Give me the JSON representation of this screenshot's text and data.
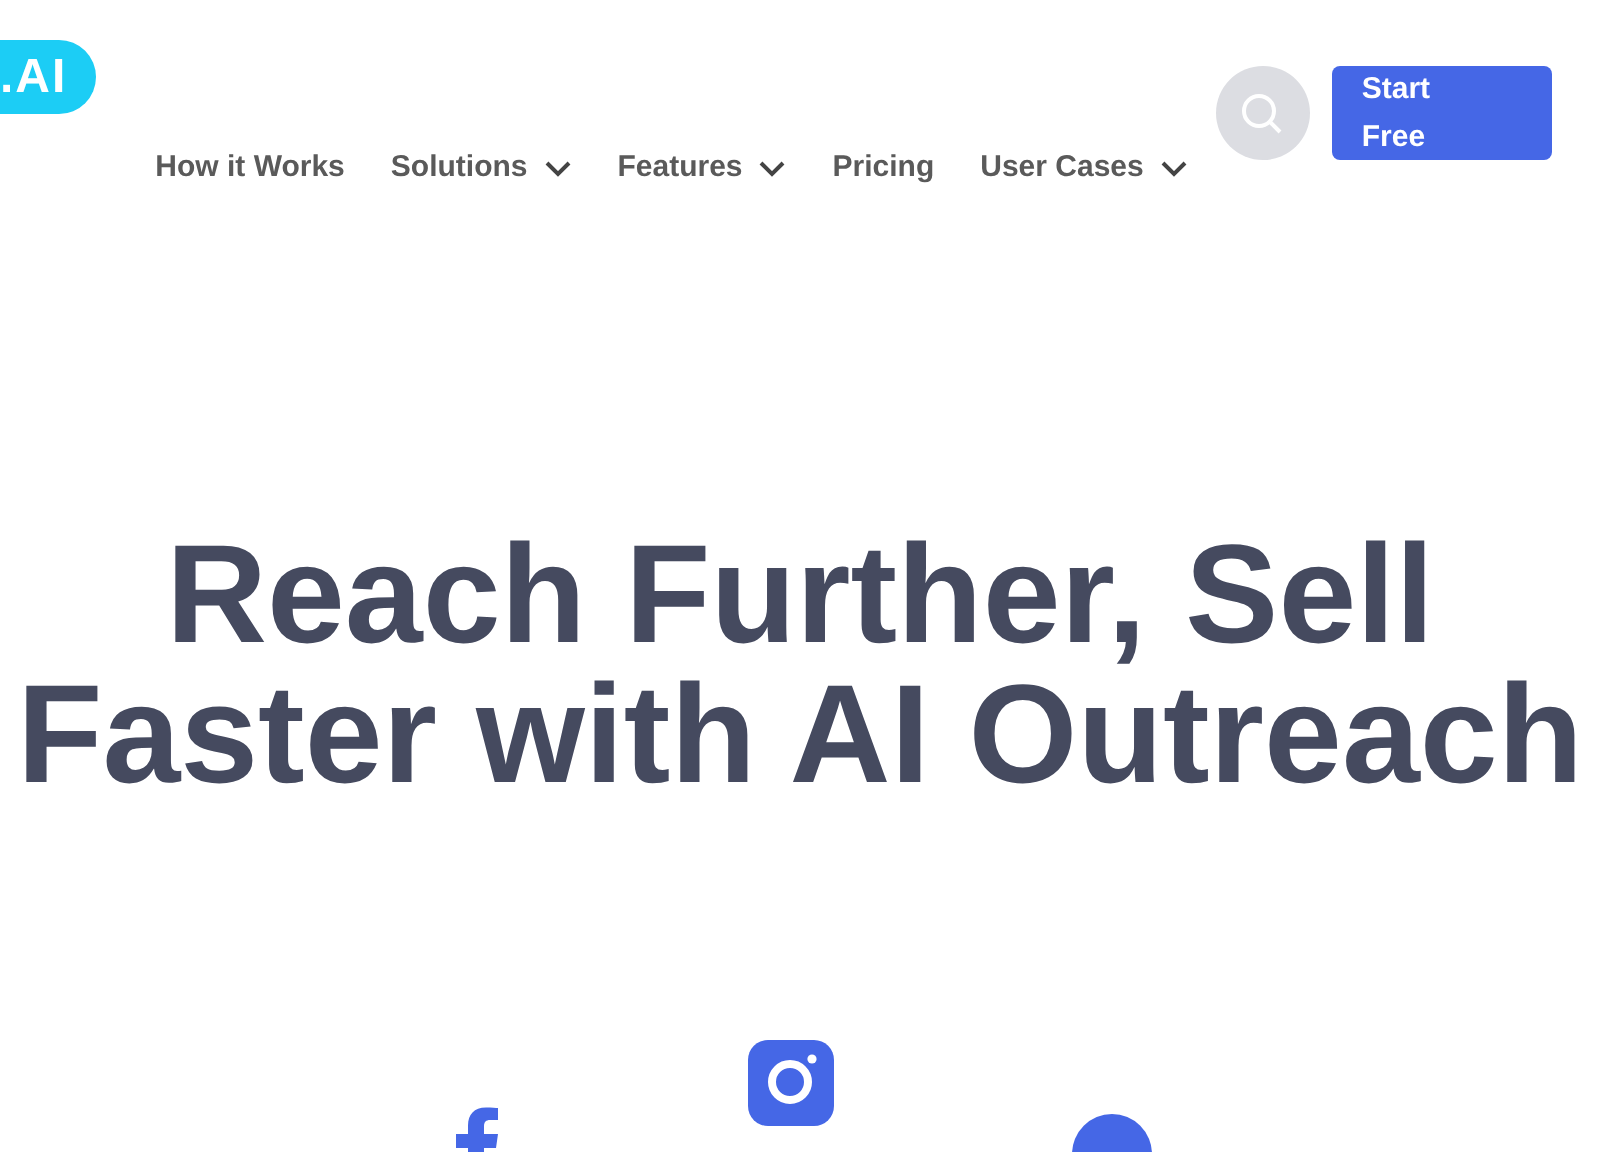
{
  "logo": {
    "text": ".AI"
  },
  "nav": [
    {
      "label": "How it Works",
      "dropdown": false
    },
    {
      "label": "Solutions",
      "dropdown": true
    },
    {
      "label": "Features",
      "dropdown": true
    },
    {
      "label": "Pricing",
      "dropdown": false
    },
    {
      "label": "User Cases",
      "dropdown": true
    }
  ],
  "cta": {
    "label": "Start Free"
  },
  "hero": {
    "title_lines": [
      "Reach Further, Sell",
      "Faster with AI Outreach"
    ]
  },
  "social_icons": [
    {
      "kind": "facebook"
    },
    {
      "kind": "instagram"
    },
    {
      "kind": "round"
    }
  ]
}
